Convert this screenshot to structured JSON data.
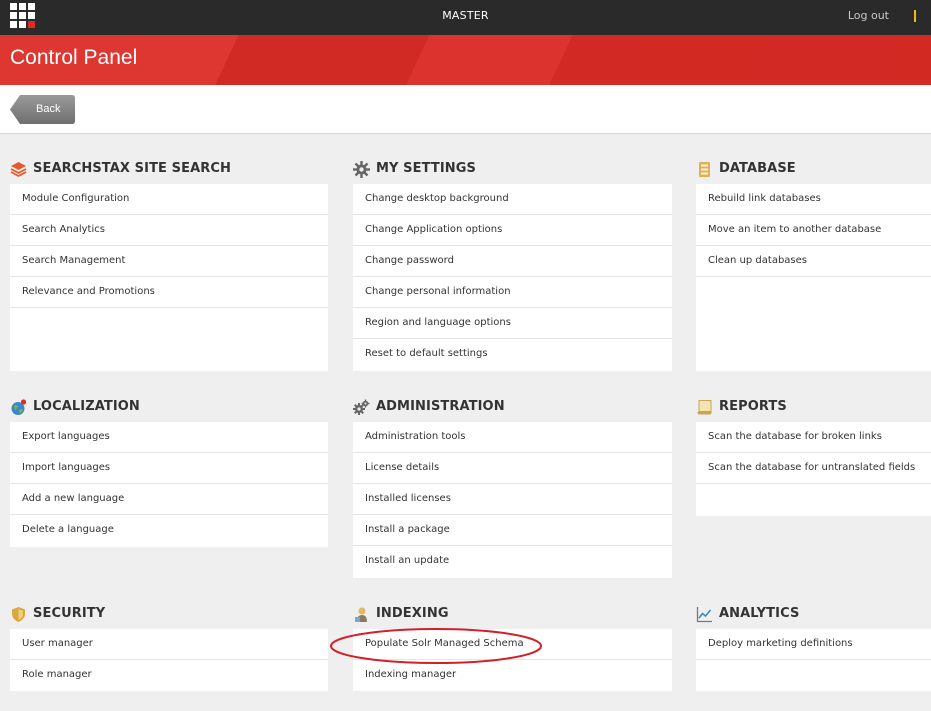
{
  "topbar": {
    "title": "MASTER",
    "logout": "Log out"
  },
  "header": {
    "title": "Control Panel"
  },
  "toolbar": {
    "back": "Back"
  },
  "colors": {
    "brand_red": "#dc2b25",
    "topbar": "#2a2a2a",
    "accent_yellow": "#e6c100",
    "annotation_red": "#d41f2a"
  },
  "sections": {
    "searchstax": {
      "title": "SEARCHSTAX SITE SEARCH",
      "icon": "stack-layers-icon",
      "items": [
        "Module Configuration",
        "Search Analytics",
        "Search Management",
        "Relevance and Promotions"
      ]
    },
    "mysettings": {
      "title": "MY SETTINGS",
      "icon": "gear-icon",
      "items": [
        "Change desktop background",
        "Change Application options",
        "Change password",
        "Change personal information",
        "Region and language options",
        "Reset to default settings"
      ]
    },
    "database": {
      "title": "DATABASE",
      "icon": "database-icon",
      "items": [
        "Rebuild link databases",
        "Move an item to another database",
        "Clean up databases"
      ]
    },
    "localization": {
      "title": "LOCALIZATION",
      "icon": "globe-icon",
      "items": [
        "Export languages",
        "Import languages",
        "Add a new language",
        "Delete a language"
      ]
    },
    "administration": {
      "title": "ADMINISTRATION",
      "icon": "gears-icon",
      "items": [
        "Administration tools",
        "License details",
        "Installed licenses",
        "Install a package",
        "Install an update"
      ]
    },
    "reports": {
      "title": "REPORTS",
      "icon": "report-icon",
      "items": [
        "Scan the database for broken links",
        "Scan the database for untranslated fields"
      ]
    },
    "security": {
      "title": "SECURITY",
      "icon": "shield-icon",
      "items": [
        "User manager",
        "Role manager"
      ]
    },
    "indexing": {
      "title": "INDEXING",
      "icon": "indexing-icon",
      "items": [
        "Populate Solr Managed Schema",
        "Indexing manager"
      ]
    },
    "analytics": {
      "title": "ANALYTICS",
      "icon": "chart-icon",
      "items": [
        "Deploy marketing definitions"
      ]
    }
  }
}
